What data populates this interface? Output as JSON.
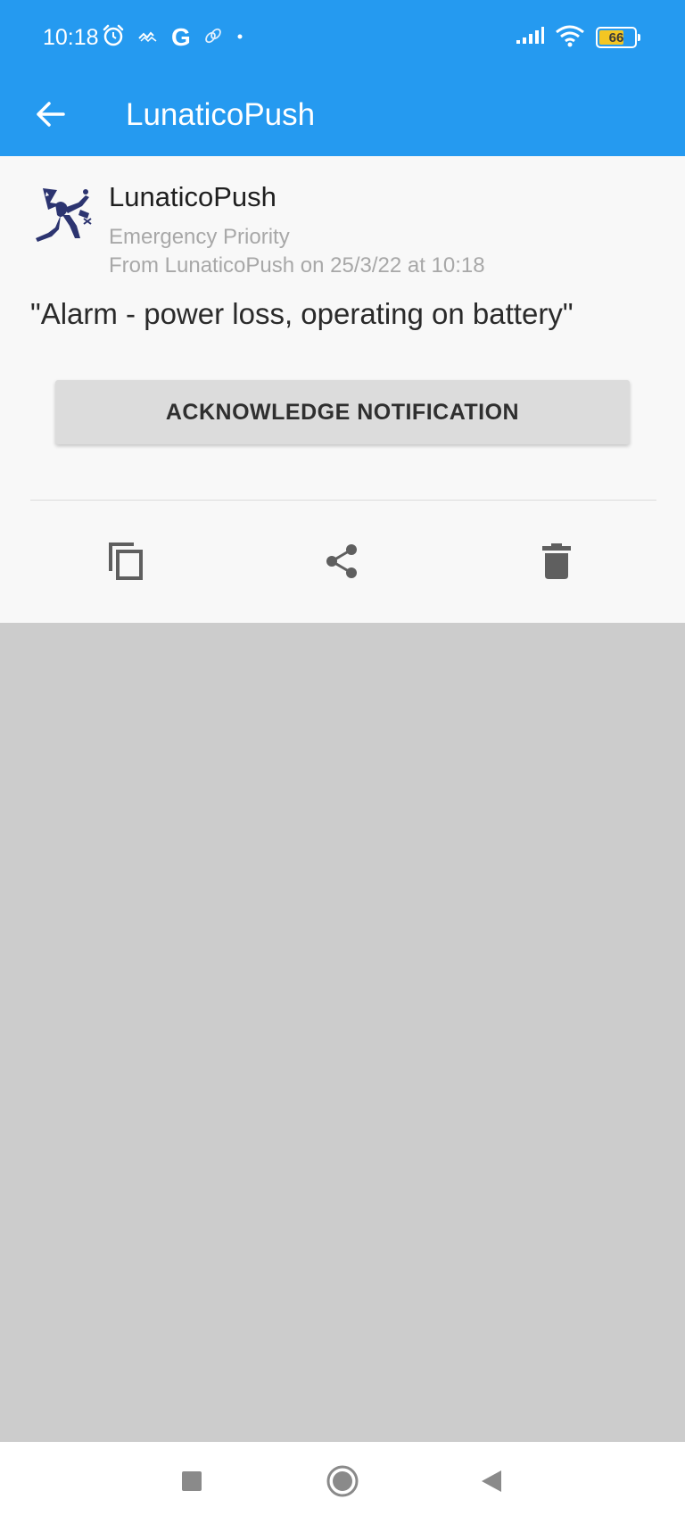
{
  "status_bar": {
    "time": "10:18",
    "g_letter": "G",
    "battery_level": "66",
    "icons": [
      "alarm-icon",
      "activity-icon",
      "google-icon",
      "link-icon",
      "dot-icon",
      "signal-icon",
      "wifi-icon",
      "battery-icon"
    ],
    "battery_color": "#f3c623"
  },
  "toolbar": {
    "title": "LunaticoPush",
    "back_icon": "arrow-left-icon",
    "color": "#259af0"
  },
  "notification": {
    "app_name": "LunaticoPush",
    "priority": "Emergency Priority",
    "from_line": "From LunaticoPush on 25/3/22 at 10:18",
    "message": "\"Alarm - power loss, operating on battery\"",
    "acknowledge_label": "ACKNOWLEDGE NOTIFICATION",
    "actions": [
      "copy-icon",
      "share-icon",
      "delete-icon"
    ],
    "logo_color": "#2c3470"
  },
  "nav_bar": {
    "buttons": [
      "recents-icon",
      "home-icon",
      "back-icon"
    ]
  }
}
